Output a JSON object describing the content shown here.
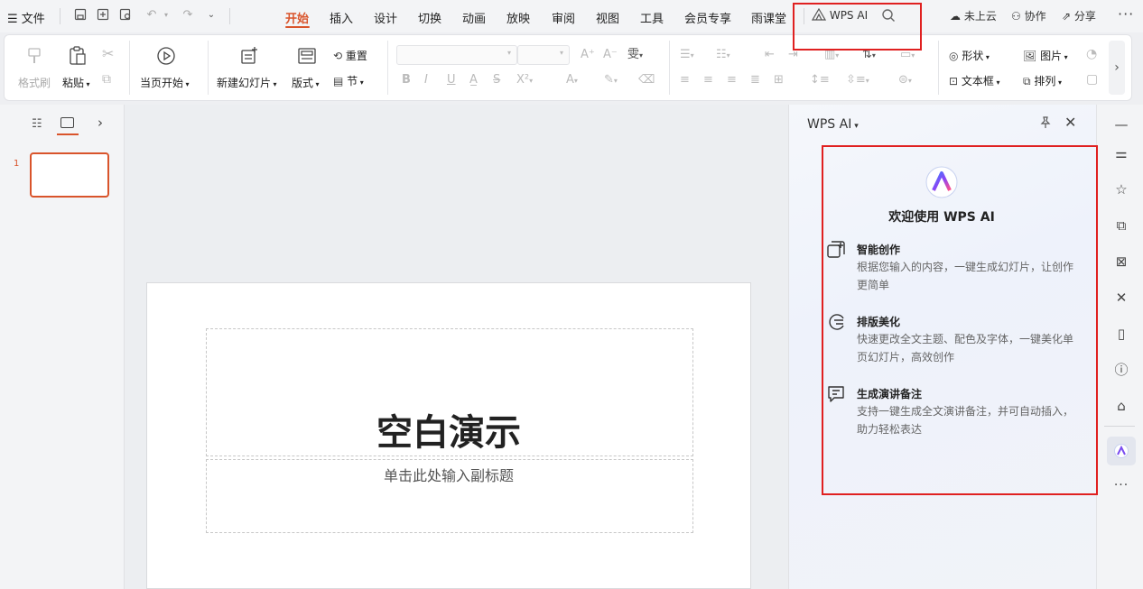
{
  "menubar": {
    "file_label": "文件",
    "tabs": [
      "开始",
      "插入",
      "设计",
      "切换",
      "动画",
      "放映",
      "审阅",
      "视图",
      "工具",
      "会员专享",
      "雨课堂"
    ],
    "active_tab": "开始",
    "wps_ai_label": "WPS AI",
    "cloud_label": "未上云",
    "collab_label": "协作",
    "share_label": "分享"
  },
  "ribbon": {
    "format_painter": "格式刷",
    "paste": "粘贴",
    "from_current": "当页开始",
    "new_slide": "新建幻灯片",
    "layout": "版式",
    "reset": "重置",
    "section": "节",
    "shape": "形状",
    "picture": "图片",
    "textbox": "文本框",
    "arrange": "排列"
  },
  "slide": {
    "number": "1",
    "title": "空白演示",
    "subtitle": "单击此处输入副标题"
  },
  "ai_panel": {
    "header": "WPS AI",
    "welcome": "欢迎使用 WPS AI",
    "features": [
      {
        "title": "智能创作",
        "desc": "根据您输入的内容，一键生成幻灯片，让创作更简单"
      },
      {
        "title": "排版美化",
        "desc": "快速更改全文主题、配色及字体，一键美化单页幻灯片，高效创作"
      },
      {
        "title": "生成演讲备注",
        "desc": "支持一键生成全文演讲备注，并可自动插入，助力轻松表达"
      }
    ]
  },
  "colors": {
    "accent": "#d9542b",
    "highlight_box": "#e02020"
  }
}
